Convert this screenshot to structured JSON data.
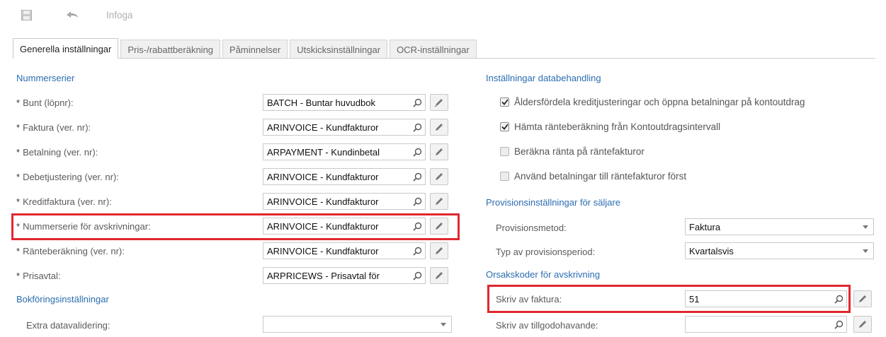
{
  "toolbar": {
    "insert_label": "Infoga"
  },
  "tabs": [
    {
      "label": "Generella inställningar",
      "active": true
    },
    {
      "label": "Pris-/rabattberäkning",
      "active": false
    },
    {
      "label": "Påminnelser",
      "active": false
    },
    {
      "label": "Utskicksinställningar",
      "active": false
    },
    {
      "label": "OCR-inställningar",
      "active": false
    }
  ],
  "left": {
    "numbering_title": "Nummerserier",
    "rows": [
      {
        "label": "Bunt (löpnr):",
        "value": "BATCH - Buntar huvudbok"
      },
      {
        "label": "Faktura (ver. nr):",
        "value": "ARINVOICE - Kundfakturor"
      },
      {
        "label": "Betalning (ver. nr):",
        "value": "ARPAYMENT - Kundinbetal"
      },
      {
        "label": "Debetjustering (ver. nr):",
        "value": "ARINVOICE - Kundfakturor"
      },
      {
        "label": "Kreditfaktura (ver. nr):",
        "value": "ARINVOICE - Kundfakturor"
      },
      {
        "label": "Nummerserie för avskrivningar:",
        "value": "ARINVOICE - Kundfakturor"
      },
      {
        "label": "Ränteberäkning (ver. nr):",
        "value": "ARINVOICE - Kundfakturor"
      },
      {
        "label": "Prisavtal:",
        "value": "ARPRICEWS - Prisavtal för"
      }
    ],
    "required_marker": "*",
    "posting_title": "Bokföringsinställningar",
    "extra_validation_label": "Extra datavalidering:",
    "extra_validation_value": ""
  },
  "right": {
    "data_title": "Inställningar databehandling",
    "checks": [
      {
        "label": "Åldersfördela kreditjusteringar och öppna betalningar på kontoutdrag",
        "checked": true
      },
      {
        "label": "Hämta ränteberäkning från Kontoutdragsintervall",
        "checked": true
      },
      {
        "label": "Beräkna ränta på räntefakturor",
        "checked": false
      },
      {
        "label": "Använd betalningar till räntefakturor först",
        "checked": false
      }
    ],
    "commission_title": "Provisionsinställningar för säljare",
    "commission_method_label": "Provisionsmetod:",
    "commission_method_value": "Faktura",
    "commission_period_label": "Typ av provisionsperiod:",
    "commission_period_value": "Kvartalsvis",
    "reason_title": "Orsakskoder för avskrivning",
    "write_off_invoice_label": "Skriv av faktura:",
    "write_off_invoice_value": "51",
    "write_off_credit_label": "Skriv av tillgodohavande:",
    "write_off_credit_value": ""
  },
  "colors": {
    "section_blue": "#2b6cb0",
    "highlight_red": "#e0282e"
  }
}
